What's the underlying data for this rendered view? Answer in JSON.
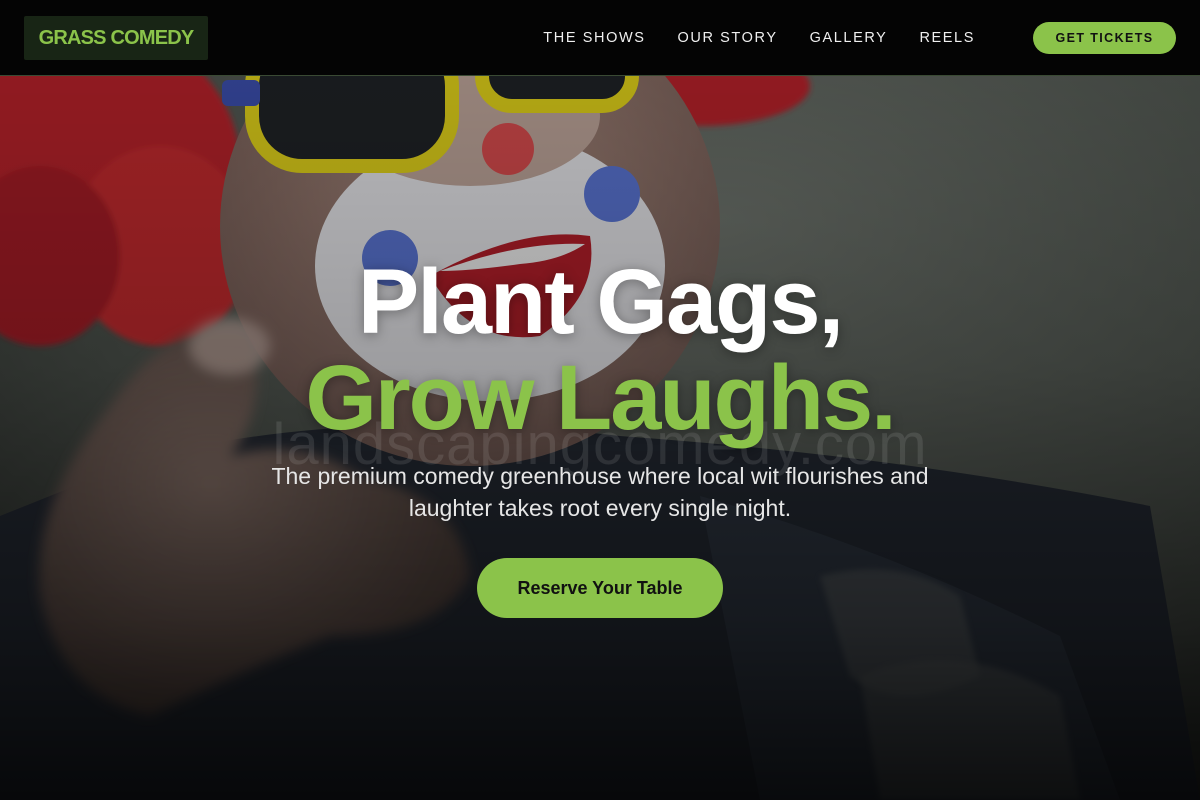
{
  "header": {
    "logo_text": "GRASS COMEDY",
    "nav": [
      {
        "label": "THE SHOWS"
      },
      {
        "label": "OUR STORY"
      },
      {
        "label": "GALLERY"
      },
      {
        "label": "REELS"
      }
    ],
    "cta_label": "GET TICKETS"
  },
  "hero": {
    "title_line1": "Plant Gags,",
    "title_line2": "Grow Laughs.",
    "subtitle": "The premium comedy greenhouse where local wit flourishes and laughter takes root every single night.",
    "button_label": "Reserve Your Table",
    "background_image": "clown-photo",
    "watermark": "landscapingcomedy.com"
  },
  "colors": {
    "accent": "#8bc34a",
    "header_bg": "#040404",
    "logo_bg": "#182515",
    "text_light": "#ffffff"
  }
}
